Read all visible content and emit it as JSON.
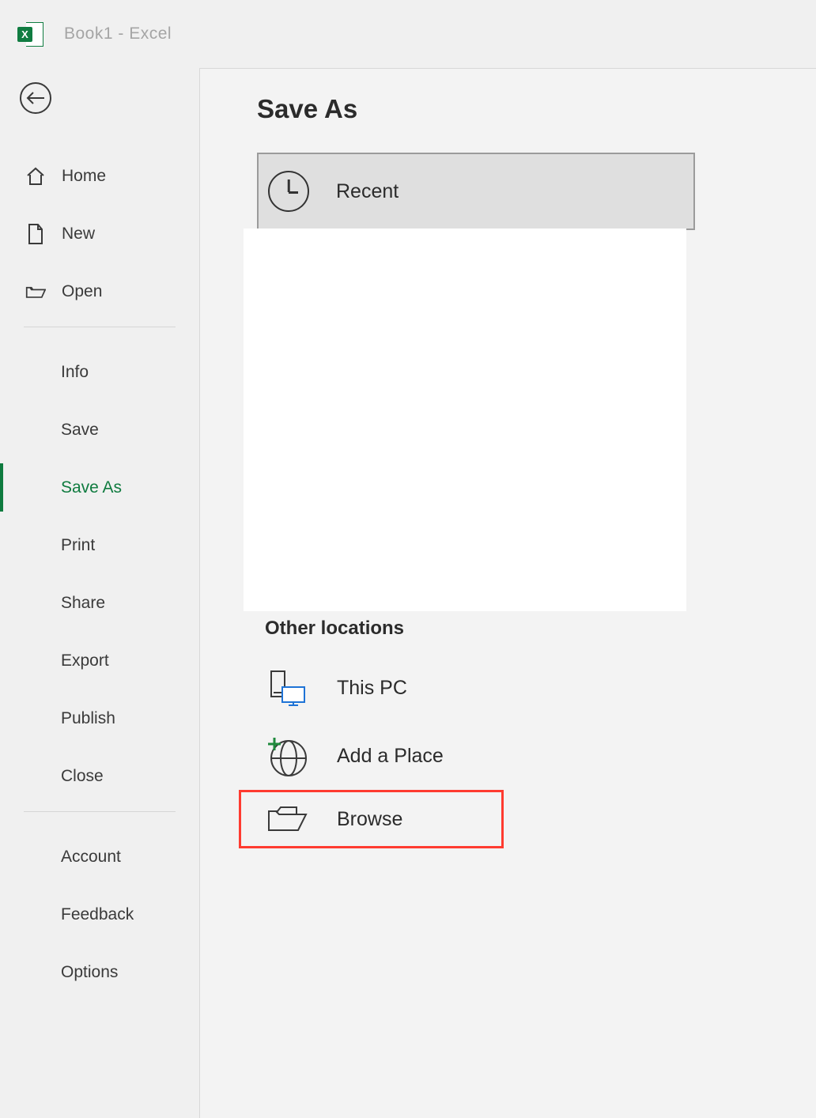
{
  "titlebar": {
    "document_title": "Book1  -  Excel",
    "logo_letter": "X"
  },
  "sidebar": {
    "primary": [
      {
        "id": "home",
        "label": "Home",
        "icon": "home-icon"
      },
      {
        "id": "new",
        "label": "New",
        "icon": "new-file-icon"
      },
      {
        "id": "open",
        "label": "Open",
        "icon": "folder-open-icon"
      }
    ],
    "secondary": [
      {
        "id": "info",
        "label": "Info"
      },
      {
        "id": "save",
        "label": "Save"
      },
      {
        "id": "save-as",
        "label": "Save As",
        "active": true
      },
      {
        "id": "print",
        "label": "Print"
      },
      {
        "id": "share",
        "label": "Share"
      },
      {
        "id": "export",
        "label": "Export"
      },
      {
        "id": "publish",
        "label": "Publish"
      },
      {
        "id": "close",
        "label": "Close"
      }
    ],
    "footer": [
      {
        "id": "account",
        "label": "Account"
      },
      {
        "id": "feedback",
        "label": "Feedback"
      },
      {
        "id": "options",
        "label": "Options"
      }
    ]
  },
  "main": {
    "page_title": "Save As",
    "recent_label": "Recent",
    "other_heading": "Other locations",
    "locations": {
      "this_pc": "This PC",
      "add_place": "Add a Place",
      "browse": "Browse"
    }
  }
}
